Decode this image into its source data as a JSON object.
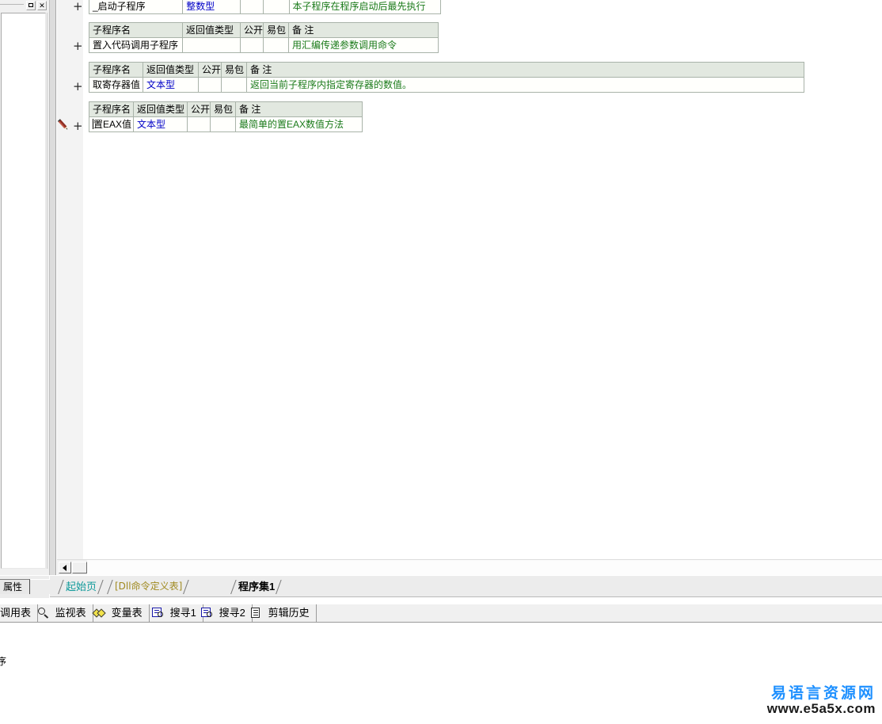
{
  "left_panel": {
    "maximize_label": "□",
    "close_label": "✕",
    "properties_tab_label": "属性"
  },
  "editor": {
    "expander_symbol": "+",
    "edit_marker_icon": "pencil-icon",
    "tables": [
      {
        "id": "table-startup-routine",
        "headers": [],
        "row": {
          "name": "_启动子程序",
          "return_type": "整数型",
          "public": "",
          "easy_pack": "",
          "note": "本子程序在程序启动后最先执行"
        }
      },
      {
        "id": "table-inline-asm-call",
        "headers": [
          "子程序名",
          "返回值类型",
          "公开",
          "易包",
          "备 注"
        ],
        "row": {
          "name": "置入代码调用子程序",
          "return_type": "",
          "public": "",
          "easy_pack": "",
          "note": "用汇编传递参数调用命令"
        }
      },
      {
        "id": "table-get-register",
        "headers": [
          "子程序名",
          "返回值类型",
          "公开",
          "易包",
          "备 注"
        ],
        "row": {
          "name": "取寄存器值",
          "return_type": "文本型",
          "public": "",
          "easy_pack": "",
          "note": "返回当前子程序内指定寄存器的数值。"
        }
      },
      {
        "id": "table-set-eax",
        "headers": [
          "子程序名",
          "返回值类型",
          "公开",
          "易包",
          "备 注"
        ],
        "row": {
          "name": "置EAX值",
          "return_type": "文本型",
          "public": "",
          "easy_pack": "",
          "note": "最简单的置EAX数值方法"
        }
      }
    ]
  },
  "scrollbar": {
    "left_arrow_label": "◀"
  },
  "doc_tabs": [
    {
      "label": "起始页",
      "color": "#0f9a9a",
      "active": false
    },
    {
      "label": "[Dll命令定义表]",
      "color": "#a08a20",
      "active": false
    },
    {
      "label": "程序集1",
      "color": "#000000",
      "active": true
    }
  ],
  "tool_tabs": [
    {
      "label": "调用表",
      "icon": ""
    },
    {
      "label": "监视表",
      "icon": "magnifier-icon"
    },
    {
      "label": "变量表",
      "icon": "diamonds-icon"
    },
    {
      "label": "搜寻1",
      "icon": "book-search-icon"
    },
    {
      "label": "搜寻2",
      "icon": "book-search-icon"
    },
    {
      "label": "剪辑历史",
      "icon": "clipboard-history-icon"
    }
  ],
  "output": {
    "text": "序"
  },
  "watermark": {
    "cn": "易语言资源网",
    "url": "www.e5a5x.com",
    "cn_color": "#1e90ff"
  },
  "colors": {
    "table_header_bg": "#e2e8e0",
    "table_row_bg": "#fffffc",
    "table_border": "#a9b3a9",
    "type_text": "#0000c8",
    "note_text": "#1a7a1a",
    "active_tab_text": "#000000"
  }
}
